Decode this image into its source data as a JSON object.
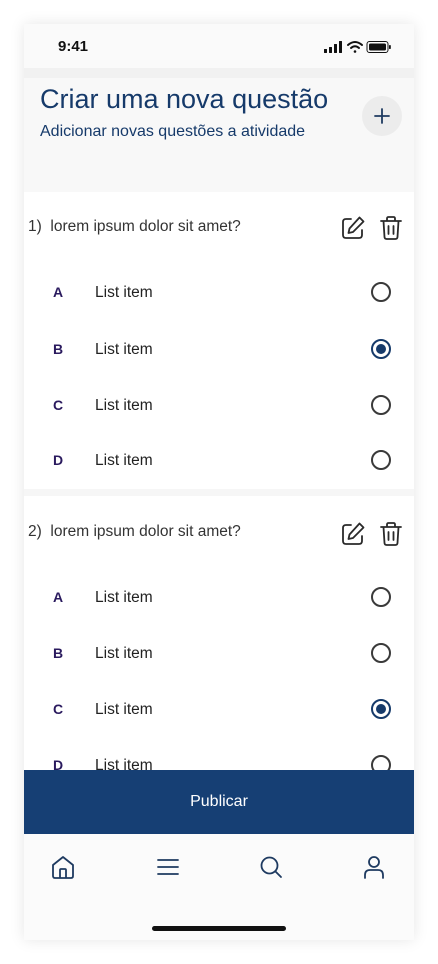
{
  "status_bar": {
    "time": "9:41"
  },
  "header": {
    "title": "Criar uma nova questão",
    "subtitle": "Adicionar novas questões a atividade"
  },
  "questions": [
    {
      "number": "1)",
      "text": "lorem ipsum dolor sit amet?",
      "options": [
        {
          "letter": "A",
          "label": "List item",
          "selected": false
        },
        {
          "letter": "B",
          "label": "List item",
          "selected": true
        },
        {
          "letter": "C",
          "label": "List item",
          "selected": false
        },
        {
          "letter": "D",
          "label": "List item",
          "selected": false
        }
      ]
    },
    {
      "number": "2)",
      "text": "lorem ipsum dolor sit amet?",
      "options": [
        {
          "letter": "A",
          "label": "List item",
          "selected": false
        },
        {
          "letter": "B",
          "label": "List item",
          "selected": false
        },
        {
          "letter": "C",
          "label": "List item",
          "selected": true
        },
        {
          "letter": "D",
          "label": "List item",
          "selected": false
        }
      ]
    }
  ],
  "publish_button": {
    "label": "Publicar"
  },
  "bottom_nav": {
    "items": [
      {
        "icon": "home-icon"
      },
      {
        "icon": "menu-icon"
      },
      {
        "icon": "search-icon"
      },
      {
        "icon": "profile-icon"
      }
    ]
  },
  "colors": {
    "primary": "#163f74",
    "title": "#163a6a",
    "option_letter": "#2a1a5e"
  }
}
